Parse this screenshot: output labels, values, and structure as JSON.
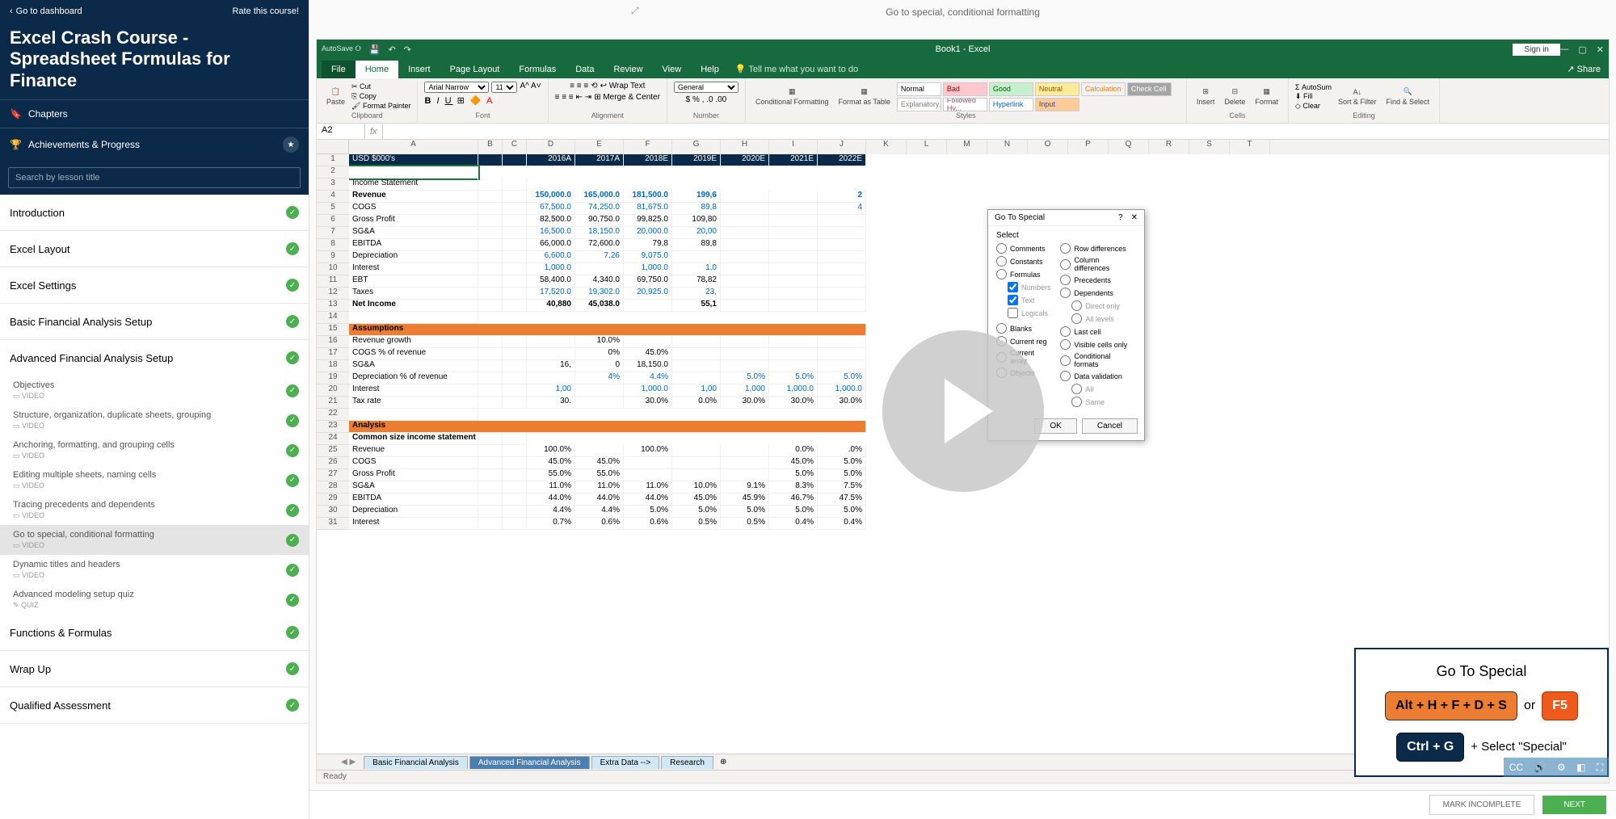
{
  "sidebar": {
    "back_label": "Go to dashboard",
    "rate_label": "Rate this course!",
    "course_title": "Excel Crash Course - Spreadsheet Formulas for Finance",
    "chapters_label": "Chapters",
    "achievements_label": "Achievements & Progress",
    "search_placeholder": "Search by lesson title",
    "chapters": [
      {
        "title": "Introduction",
        "done": true
      },
      {
        "title": "Excel Layout",
        "done": true
      },
      {
        "title": "Excel Settings",
        "done": true
      },
      {
        "title": "Basic Financial Analysis Setup",
        "done": true
      },
      {
        "title": "Advanced Financial Analysis Setup",
        "done": true,
        "expanded": true,
        "lessons": [
          {
            "title": "Objectives",
            "type": "VIDEO",
            "done": true
          },
          {
            "title": "Structure, organization, duplicate sheets, grouping",
            "type": "VIDEO",
            "done": true
          },
          {
            "title": "Anchoring, formatting, and grouping cells",
            "type": "VIDEO",
            "done": true
          },
          {
            "title": "Editing multiple sheets, naming cells",
            "type": "VIDEO",
            "done": true
          },
          {
            "title": "Tracing precedents and dependents",
            "type": "VIDEO",
            "done": true
          },
          {
            "title": "Go to special, conditional formatting",
            "type": "VIDEO",
            "done": true,
            "active": true
          },
          {
            "title": "Dynamic titles and headers",
            "type": "VIDEO",
            "done": true
          },
          {
            "title": "Advanced modeling setup quiz",
            "type": "QUIZ",
            "done": true
          }
        ]
      },
      {
        "title": "Functions & Formulas",
        "done": true
      },
      {
        "title": "Wrap Up",
        "done": true
      },
      {
        "title": "Qualified Assessment",
        "done": true
      }
    ]
  },
  "main": {
    "title": "Go to special, conditional formatting",
    "mark_incomplete": "MARK INCOMPLETE",
    "next": "NEXT"
  },
  "excel": {
    "doc_title": "Book1 - Excel",
    "signin": "Sign in",
    "tabs": [
      "File",
      "Home",
      "Insert",
      "Page Layout",
      "Formulas",
      "Data",
      "Review",
      "View",
      "Help"
    ],
    "tellme": "Tell me what you want to do",
    "share": "Share",
    "ribbon": {
      "clipboard": {
        "label": "Clipboard",
        "paste": "Paste",
        "cut": "Cut",
        "copy": "Copy",
        "painter": "Format Painter"
      },
      "font": {
        "label": "Font",
        "family": "Arial Narrow",
        "size": "11"
      },
      "alignment": {
        "label": "Alignment",
        "wrap": "Wrap Text",
        "merge": "Merge & Center"
      },
      "number": {
        "label": "Number",
        "format": "General"
      },
      "cond": {
        "label": "Styles",
        "conditional": "Conditional Formatting",
        "table": "Format as Table"
      },
      "styles": [
        {
          "t": "Normal",
          "bg": "#fff",
          "c": "#000"
        },
        {
          "t": "Bad",
          "bg": "#ffc7ce",
          "c": "#9c0006"
        },
        {
          "t": "Good",
          "bg": "#c6efce",
          "c": "#006100"
        },
        {
          "t": "Neutral",
          "bg": "#ffeb9c",
          "c": "#9c5700"
        },
        {
          "t": "Calculation",
          "bg": "#f2f2f2",
          "c": "#fa7d00"
        },
        {
          "t": "Check Cell",
          "bg": "#a5a5a5",
          "c": "#fff"
        },
        {
          "t": "Explanatory...",
          "bg": "#fff",
          "c": "#7f7f7f"
        },
        {
          "t": "Followed Hy...",
          "bg": "#fff",
          "c": "#954f72"
        },
        {
          "t": "Hyperlink",
          "bg": "#fff",
          "c": "#0563c1"
        },
        {
          "t": "Input",
          "bg": "#ffcc99",
          "c": "#3f3f76"
        }
      ],
      "cells": {
        "label": "Cells",
        "insert": "Insert",
        "delete": "Delete",
        "format": "Format"
      },
      "editing": {
        "label": "Editing",
        "autosum": "AutoSum",
        "fill": "Fill",
        "clear": "Clear",
        "sort": "Sort & Filter",
        "find": "Find & Select"
      }
    },
    "namebox": "A2",
    "columns": [
      "A",
      "B",
      "C",
      "D",
      "E",
      "F",
      "G",
      "H",
      "I",
      "J",
      "K",
      "L",
      "M",
      "N",
      "O",
      "P",
      "Q",
      "R",
      "S",
      "T"
    ],
    "col_headers": [
      "USD $000's",
      "",
      "",
      "2016A",
      "2017A",
      "2018E",
      "2019E",
      "2020E",
      "2021E",
      "2022E"
    ],
    "rows": [
      {
        "r": 1,
        "type": "hdr"
      },
      {
        "r": 2,
        "type": "blank-sel"
      },
      {
        "r": 3,
        "type": "bold",
        "a": "Income Statement"
      },
      {
        "r": 4,
        "a": "Revenue",
        "vals": [
          "150,000.0",
          "165,000.0",
          "181,500.0",
          "199,6",
          "",
          "",
          "2"
        ],
        "blue": true,
        "bold": true
      },
      {
        "r": 5,
        "a": "COGS",
        "vals": [
          "67,500.0",
          "74,250.0",
          "81,675.0",
          "89,8",
          "",
          "",
          "4"
        ],
        "blue": true
      },
      {
        "r": 6,
        "a": "Gross Profit",
        "vals": [
          "82,500.0",
          "90,750.0",
          "99,825.0",
          "109,80",
          "",
          "",
          ""
        ]
      },
      {
        "r": 7,
        "a": "SG&A",
        "vals": [
          "16,500.0",
          "18,150.0",
          "20,000.0",
          "20,00",
          "",
          "",
          ""
        ],
        "blue": true
      },
      {
        "r": 8,
        "a": "EBITDA",
        "vals": [
          "66,000.0",
          "72,600.0",
          "79,8",
          "89,8",
          "",
          "",
          ""
        ]
      },
      {
        "r": 9,
        "a": "Depreciation",
        "vals": [
          "6,600.0",
          "7,26",
          "9,075.0",
          "",
          "",
          "",
          ""
        ],
        "blue": true
      },
      {
        "r": 10,
        "a": "Interest",
        "vals": [
          "1,000.0",
          "",
          "1,000.0",
          "1,0",
          "",
          "",
          ""
        ],
        "blue": true
      },
      {
        "r": 11,
        "a": "EBT",
        "vals": [
          "58,400.0",
          "4,340.0",
          "69,750.0",
          "78,82",
          "",
          "",
          ""
        ]
      },
      {
        "r": 12,
        "a": "Taxes",
        "vals": [
          "17,520.0",
          "19,302.0",
          "20,925.0",
          "23,",
          "",
          "",
          ""
        ],
        "blue": true
      },
      {
        "r": 13,
        "a": "Net Income",
        "vals": [
          "40,880",
          "45,038.0",
          "",
          "55,1",
          "",
          "",
          ""
        ],
        "bold": true
      },
      {
        "r": 14,
        "type": "blank"
      },
      {
        "r": 15,
        "type": "section",
        "a": "Assumptions"
      },
      {
        "r": 16,
        "a": "Revenue growth",
        "vals": [
          "",
          "10.0%",
          "",
          "",
          "",
          "",
          ""
        ]
      },
      {
        "r": 17,
        "a": "COGS % of revenue",
        "vals": [
          "",
          "0%",
          "45.0%",
          "",
          "",
          "",
          ""
        ]
      },
      {
        "r": 18,
        "a": "SG&A",
        "vals": [
          "16,",
          "0",
          "18,150.0",
          "",
          "",
          "",
          ""
        ]
      },
      {
        "r": 19,
        "a": "Depreciation % of revenue",
        "vals": [
          "",
          "4%",
          "4.4%",
          "",
          "5.0%",
          "5.0%",
          "5.0%"
        ],
        "blue": true
      },
      {
        "r": 20,
        "a": "Interest",
        "vals": [
          "1,00",
          "",
          "1,000.0",
          "1,00",
          "1,000",
          "1,000.0",
          "1,000.0"
        ],
        "blue": true
      },
      {
        "r": 21,
        "a": "Tax rate",
        "vals": [
          "30.",
          "",
          "30.0%",
          "0.0%",
          "30.0%",
          "30.0%",
          "30.0%"
        ]
      },
      {
        "r": 22,
        "type": "blank"
      },
      {
        "r": 23,
        "type": "section",
        "a": "Analysis"
      },
      {
        "r": 24,
        "a": "Common size income statement",
        "bold": true
      },
      {
        "r": 25,
        "a": "Revenue",
        "vals": [
          "100.0%",
          "",
          "100.0%",
          "",
          "",
          "0.0%",
          ".0%"
        ]
      },
      {
        "r": 26,
        "a": "COGS",
        "vals": [
          "45.0%",
          "45.0%",
          "",
          "",
          "",
          "45.0%",
          "5.0%"
        ]
      },
      {
        "r": 27,
        "a": "Gross Profit",
        "vals": [
          "55.0%",
          "55.0%",
          "",
          "",
          "",
          "5.0%",
          "5.0%"
        ]
      },
      {
        "r": 28,
        "a": "SG&A",
        "vals": [
          "11.0%",
          "11.0%",
          "11.0%",
          "10.0%",
          "9.1%",
          "8.3%",
          "7.5%"
        ]
      },
      {
        "r": 29,
        "a": "EBITDA",
        "vals": [
          "44.0%",
          "44.0%",
          "44.0%",
          "45.0%",
          "45.9%",
          "46.7%",
          "47.5%"
        ]
      },
      {
        "r": 30,
        "a": "Depreciation",
        "vals": [
          "4.4%",
          "4.4%",
          "5.0%",
          "5.0%",
          "5.0%",
          "5.0%",
          "5.0%"
        ]
      },
      {
        "r": 31,
        "a": "Interest",
        "vals": [
          "0.7%",
          "0.6%",
          "0.6%",
          "0.5%",
          "0.5%",
          "0.4%",
          "0.4%"
        ]
      }
    ],
    "sheet_tabs": [
      "Basic Financial Analysis",
      "Advanced Financial Analysis",
      "Extra Data -->",
      "Research"
    ],
    "status": "Ready"
  },
  "goto": {
    "title": "Go To Special",
    "select": "Select",
    "left": [
      "Comments",
      "Constants",
      "Formulas",
      "Numbers",
      "Text",
      "Logicals",
      "",
      "Blanks",
      "Current reg",
      "Current array",
      "Objects"
    ],
    "right": [
      "Row differences",
      "Column differences",
      "Precedents",
      "Dependents",
      "Direct only",
      "All levels",
      "Last cell",
      "Visible cells only",
      "Conditional formats",
      "Data validation",
      "All",
      "Same"
    ],
    "ok": "OK",
    "cancel": "Cancel"
  },
  "shortcut": {
    "title": "Go To Special",
    "key1": "Alt + H + F + D + S",
    "or": "or",
    "key2": "F5",
    "key3": "Ctrl + G",
    "sub": "+ Select \"Special\""
  }
}
